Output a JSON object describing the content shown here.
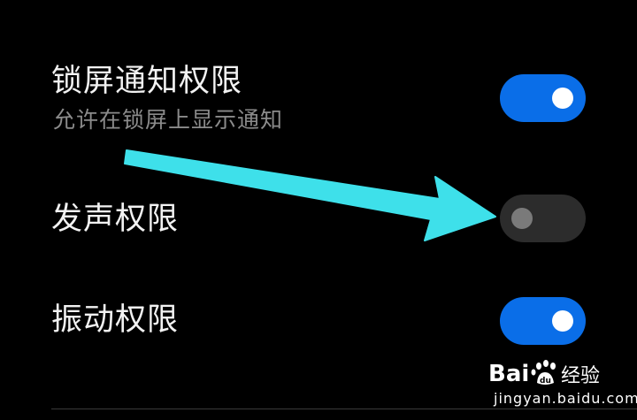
{
  "settings": {
    "items": [
      {
        "title": "锁屏通知权限",
        "subtitle": "允许在锁屏上显示通知",
        "enabled": true
      },
      {
        "title": "发声权限",
        "enabled": false
      },
      {
        "title": "振动权限",
        "enabled": true
      }
    ]
  },
  "annotation": {
    "type": "arrow",
    "color": "#3ee0ea",
    "points_to": "发声权限 toggle"
  },
  "watermark": {
    "brand": "Bai 经验",
    "url": "jingyan.baidu.com"
  },
  "colors": {
    "background": "#000000",
    "toggle_on": "#0a6ee8",
    "toggle_off": "#2c2c2c",
    "title_text": "#f2f2f2",
    "subtitle_text": "#8b8b8b"
  }
}
